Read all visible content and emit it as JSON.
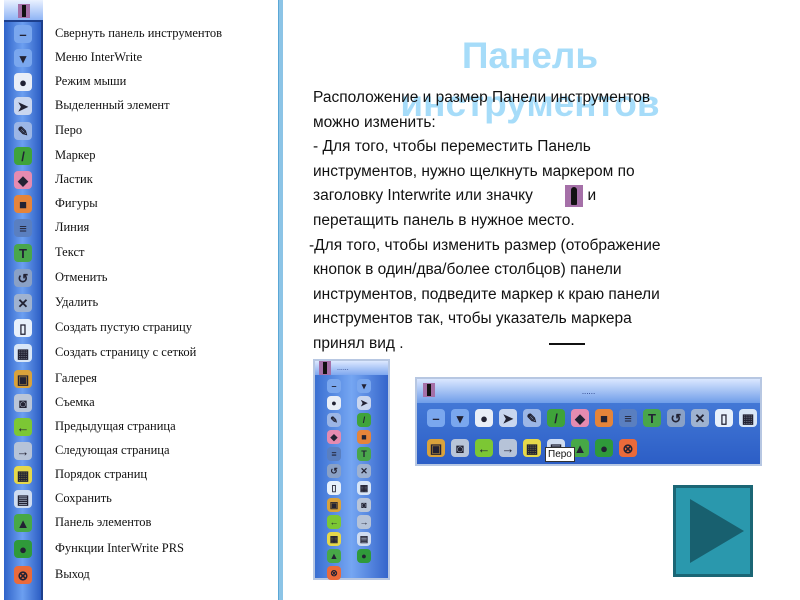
{
  "sidebar": {
    "items": [
      {
        "icon": "minimize-icon",
        "glyph": "–",
        "color": "#7aa7ee",
        "label": "Свернуть панель инструментов"
      },
      {
        "icon": "menu-icon",
        "glyph": "▾",
        "color": "#7aa7ee",
        "label": "Меню InterWrite"
      },
      {
        "icon": "mouse-icon",
        "glyph": "●",
        "color": "#e9eef7",
        "label": "Режим мыши"
      },
      {
        "icon": "select-arrow-icon",
        "glyph": "➤",
        "color": "#c9d6ef",
        "label": "Выделенный элемент"
      },
      {
        "icon": "pen-icon",
        "glyph": "✎",
        "color": "#9cb6e6",
        "label": "Перо"
      },
      {
        "icon": "marker-icon",
        "glyph": "/",
        "color": "#3fa33a",
        "label": "Маркер"
      },
      {
        "icon": "eraser-icon",
        "glyph": "◆",
        "color": "#e58bb0",
        "label": "Ластик"
      },
      {
        "icon": "shapes-icon",
        "glyph": "■",
        "color": "#e5843a",
        "label": "Фигуры"
      },
      {
        "icon": "line-icon",
        "glyph": "≡",
        "color": "#5a7fc0",
        "label": "Линия"
      },
      {
        "icon": "text-icon",
        "glyph": "T",
        "color": "#49a64b",
        "label": "Текст"
      },
      {
        "icon": "undo-icon",
        "glyph": "↺",
        "color": "#8aa1c6",
        "label": "Отменить"
      },
      {
        "icon": "delete-icon",
        "glyph": "✕",
        "color": "#9fb2d0",
        "label": "Удалить"
      },
      {
        "icon": "blank-page-icon",
        "glyph": "▯",
        "color": "#e7f0fb",
        "label": "Создать пустую страницу"
      },
      {
        "icon": "grid-page-icon",
        "glyph": "▦",
        "color": "#d8e6f7",
        "label": "Создать страницу с сеткой"
      },
      {
        "icon": "gallery-icon",
        "glyph": "▣",
        "color": "#d9a23b",
        "label": "Галерея"
      },
      {
        "icon": "camera-icon",
        "glyph": "◙",
        "color": "#b9c5d8",
        "label": "Съемка"
      },
      {
        "icon": "prev-page-icon",
        "glyph": "←",
        "color": "#7cc734",
        "label": "Предыдущая страница"
      },
      {
        "icon": "next-page-icon",
        "glyph": "→",
        "color": "#b6c3d8",
        "label": "Следующая страница"
      },
      {
        "icon": "page-order-icon",
        "glyph": "▦",
        "color": "#e6d84a",
        "label": "Порядок страниц"
      },
      {
        "icon": "save-icon",
        "glyph": "▤",
        "color": "#cfdcf0",
        "label": "Сохранить"
      },
      {
        "icon": "elements-panel-icon",
        "glyph": "▲",
        "color": "#47a847",
        "label": "Панель элементов"
      },
      {
        "icon": "prs-icon",
        "glyph": "●",
        "color": "#2f9a3a",
        "label": "Функции InterWrite PRS"
      },
      {
        "icon": "exit-icon",
        "glyph": "⊗",
        "color": "#ea6a3a",
        "label": "Выход"
      }
    ]
  },
  "title": {
    "line1": "Панель",
    "line2": "инструментов"
  },
  "body": {
    "p1": "Расположение и размер Панели инструментов",
    "p2": "можно изменить:",
    "p3": "- Для того, чтобы переместить Панель",
    "p4": "инструментов, нужно щелкнуть  маркером по",
    "p5a": "заголовку  Interwrite  или значку ",
    "p5b": " и",
    "p6": "перетащить панель в нужное место.",
    "p7": "-Для того, чтобы изменить размер (отображение",
    "p8": "кнопок в один/два/более столбцов) панели",
    "p9": "инструментов, подведите маркер к краю панели",
    "p10": "инструментов так, чтобы указатель маркера",
    "p11": "принял вид       ."
  },
  "toolbar": {
    "grip": "......",
    "tooltip": "Перо"
  },
  "colors": {
    "accent": "#2a98ad",
    "title": "#a6dcf9"
  }
}
